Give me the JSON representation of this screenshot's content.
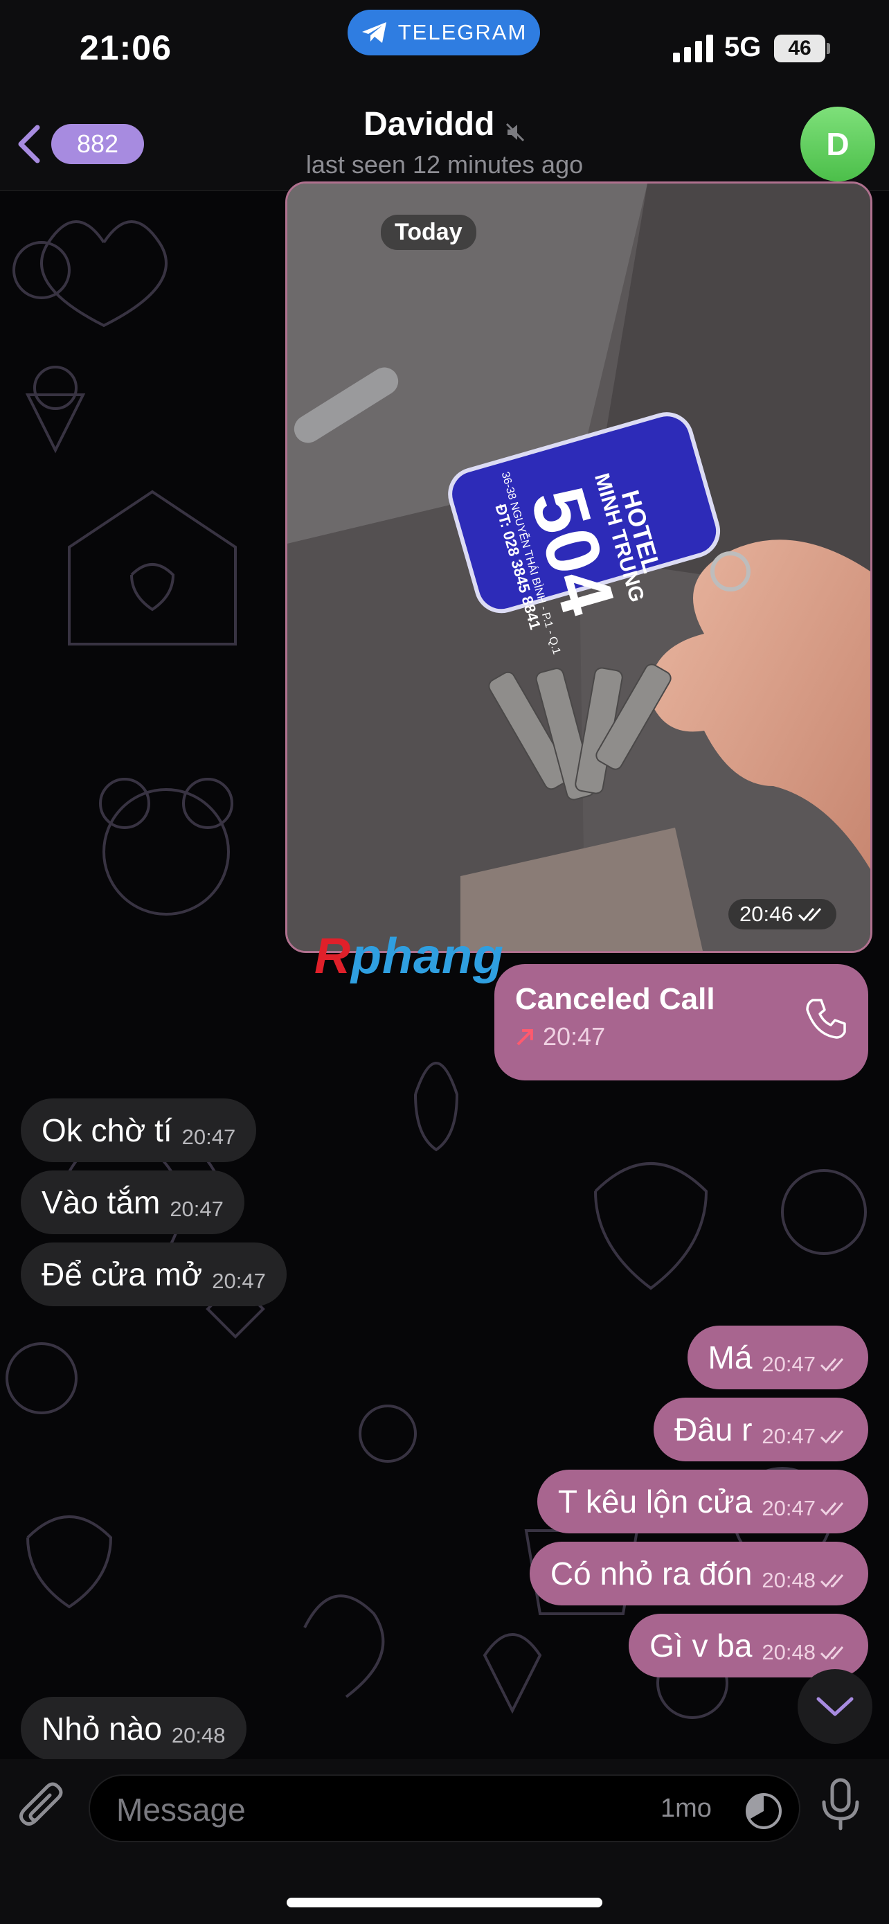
{
  "status_bar": {
    "time": "21:06",
    "app_pill": "TELEGRAM",
    "network": "5G",
    "battery": "46"
  },
  "header": {
    "back_count": "882",
    "title": "Davidd",
    "title_suffix": "d",
    "subtitle": "last seen 12 minutes ago",
    "avatar_letter": "D"
  },
  "photo_message": {
    "date_chip": "Today",
    "time": "20:46",
    "tag_line1": "HOTEL",
    "tag_line2": "MINH TRUNG",
    "tag_number": "504",
    "tag_address": "36-38 NGUYỄN THÁI BÌNH - P.1 - Q.1",
    "tag_phone": "ĐT: 028 3845 8841"
  },
  "watermark": {
    "r": "R",
    "rest": "phang"
  },
  "call_message": {
    "title": "Canceled Call",
    "time": "20:47"
  },
  "messages": [
    {
      "dir": "in",
      "text": "Ok chờ tí",
      "time": "20:47"
    },
    {
      "dir": "in",
      "text": "Vào tắm",
      "time": "20:47"
    },
    {
      "dir": "in",
      "text": "Để cửa mở",
      "time": "20:47"
    },
    {
      "dir": "out",
      "text": "Má",
      "time": "20:47"
    },
    {
      "dir": "out",
      "text": "Đâu r",
      "time": "20:47"
    },
    {
      "dir": "out",
      "text": "T kêu lộn cửa",
      "time": "20:47"
    },
    {
      "dir": "out",
      "text": "Có nhỏ ra đón",
      "time": "20:48"
    },
    {
      "dir": "out",
      "text": "Gì v ba",
      "time": "20:48"
    },
    {
      "dir": "in",
      "text": "Nhỏ nào",
      "time": "20:48"
    }
  ],
  "input": {
    "placeholder": "Message",
    "timer": "1mo"
  },
  "colors": {
    "outgoing": "#a8658f",
    "incoming": "#232325",
    "accent": "#2f7de1",
    "badge": "#a78be0",
    "avatar": "#5cc85a"
  },
  "icons": [
    "telegram-icon",
    "signal-icon",
    "chevron-left-icon",
    "mute-icon",
    "phone-icon",
    "outgoing-arrow-icon",
    "double-check-icon",
    "chevron-down-icon",
    "paperclip-icon",
    "timer-icon",
    "microphone-icon"
  ]
}
